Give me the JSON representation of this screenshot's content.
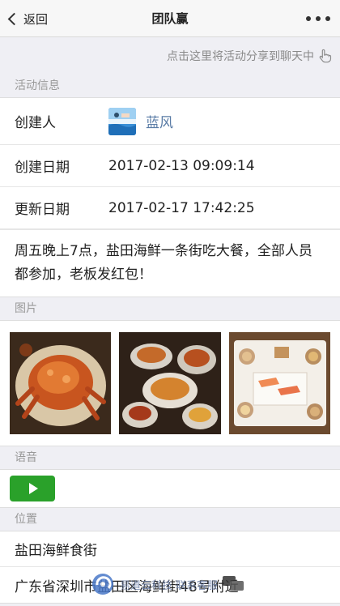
{
  "navbar": {
    "back_label": "返回",
    "title": "团队赢",
    "more_icon": "ellipsis-icon"
  },
  "share_hint": "点击这里将活动分享到聊天中",
  "activity": {
    "section_label": "活动信息",
    "creator_key": "创建人",
    "creator_name": "蓝风",
    "created_key": "创建日期",
    "created_value": "2017-02-13 09:09:14",
    "updated_key": "更新日期",
    "updated_value": "2017-02-17 17:42:25",
    "description": "周五晚上7点，盐田海鲜一条街吃大餐，全部人员都参加，老板发红包！"
  },
  "photos": {
    "section_label": "图片",
    "items": [
      "crab-dish-photo",
      "seafood-feast-photo",
      "sashimi-set-photo"
    ]
  },
  "voice": {
    "section_label": "语音",
    "play_icon": "play-icon"
  },
  "location": {
    "section_label": "位置",
    "name": "盐田海鲜食街",
    "address": "广东省深圳市盐田区海鲜街48号附近"
  },
  "watermark": "易道云科技 联系客服",
  "colors": {
    "background": "#efeff4",
    "creator_link": "#5a7ca6",
    "play_button": "#2aa12a",
    "hint_text": "#8a8a8a"
  }
}
